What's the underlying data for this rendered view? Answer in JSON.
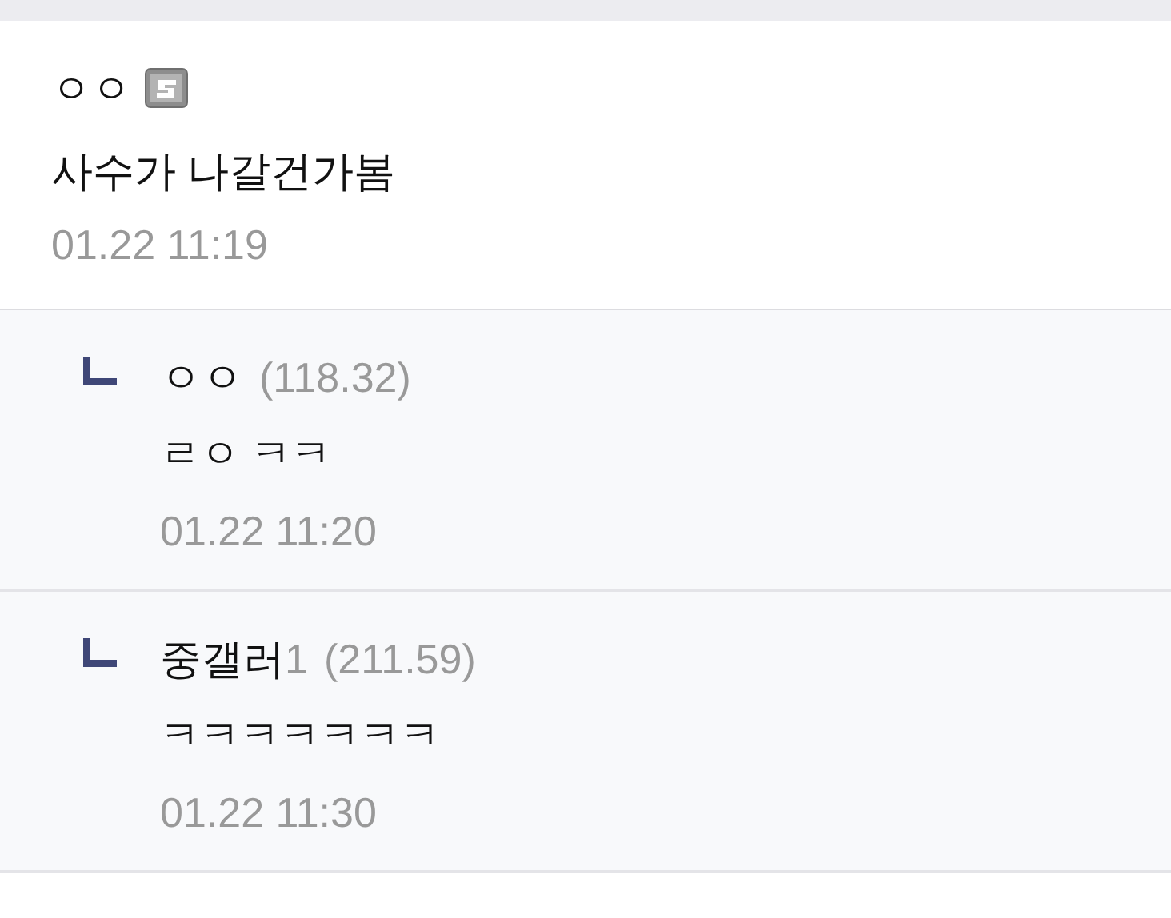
{
  "post": {
    "author": "ㅇㅇ",
    "fixed_nick_badge": true,
    "text": "사수가 나갈건가봄",
    "time": "01.22 11:19"
  },
  "replies": [
    {
      "author": "ㅇㅇ",
      "ip": "(118.32)",
      "text": "ㄹㅇ ㅋㅋ",
      "time": "01.22 11:20"
    },
    {
      "author": "중갤러",
      "author_tail": "1",
      "ip": "(211.59)",
      "text": "ㅋㅋㅋㅋㅋㅋㅋ",
      "time": "01.22 11:30"
    }
  ]
}
